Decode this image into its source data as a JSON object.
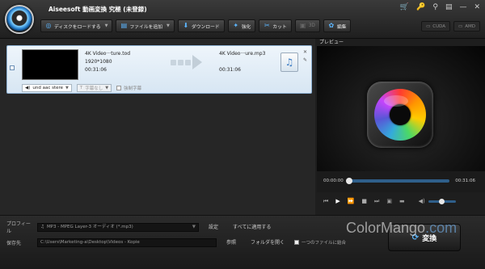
{
  "app": {
    "title": "Aiseesoft 動画変換 究極 (未登録)"
  },
  "window_icons": [
    "cart-icon",
    "key-icon",
    "pin-icon",
    "feedback-icon",
    "minimize-icon",
    "close-icon"
  ],
  "window_glyphs": [
    "🛒",
    "🔑",
    "⚲",
    "▤",
    "—",
    "✕"
  ],
  "toolbar": {
    "load_disc": "ディスクをロードする",
    "add_file": "ファイルを追加",
    "download": "ダウンロード",
    "enhance": "強化",
    "cut": "カット",
    "three_d": "3D",
    "edit": "編集",
    "cuda": "CUDA",
    "amd": "AMD"
  },
  "item": {
    "src_name": "4K Video···ture.tod",
    "src_resolution": "1920*1080",
    "src_duration": "00:31:06",
    "dst_name": "4K Video···ure.mp3",
    "dst_duration": "00:31:06",
    "audio_track": "und aac stere",
    "subtitle": "字幕なし",
    "force_subtitle": "強制字幕"
  },
  "preview": {
    "label": "プレビュー",
    "time_start": "00:00:00",
    "time_end": "00:31:06",
    "seek_position": 0.0,
    "volume": 0.5
  },
  "bottom": {
    "profile_label": "プロフィール",
    "profile_value": "MP3 - MPEG Layer-3 オーディオ (*.mp3)",
    "settings": "設定",
    "apply_all": "すべてに適用する",
    "dest_label": "保存先",
    "dest_path": "C:\\Users\\Marketing-a\\Desktop\\Videos - Kopie",
    "browse": "参照",
    "open_folder": "フォルダを開く",
    "merge": "一つのファイルに結合",
    "convert": "変換"
  },
  "watermark": {
    "text_main": "ColorMango",
    "text_suffix": ".com"
  },
  "colors": {
    "accent": "#5cb6ff",
    "item_bg": "#e3eef8",
    "seek": "#2f5f8a"
  }
}
